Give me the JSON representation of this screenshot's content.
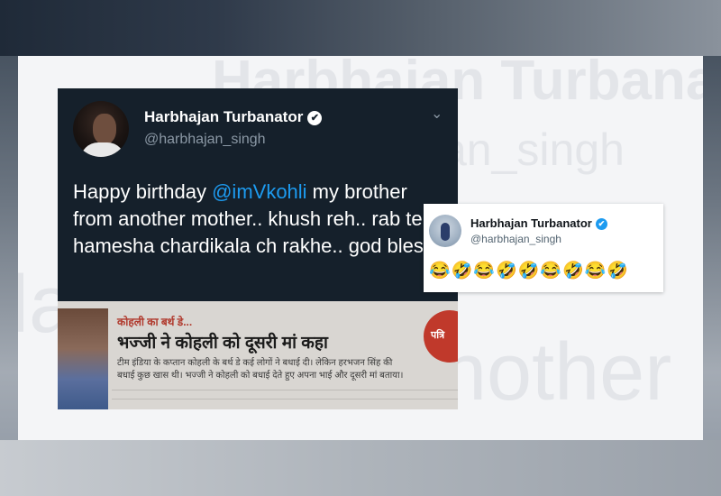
{
  "watermark": {
    "name": "Harbhajan Turbanator",
    "handle_fragment": "an_singh",
    "fragment_left": "la",
    "fragment_right": "nother"
  },
  "main_tweet": {
    "display_name": "Harbhajan Turbanator",
    "handle": "@harbhajan_singh",
    "verified_glyph": "✔",
    "more_glyph": "⌄",
    "text_before": "Happy birthday ",
    "mention": "@imVkohli",
    "text_after": " my brother from another mother.. khush reh.. rab tenu hamesha chardikala ch rakhe.. god bless",
    "accent": "#1d9bf0",
    "background": "#15202b"
  },
  "news_clipping": {
    "kicker": "कोहली का बर्थ डे...",
    "headline": "भज्जी ने कोहली को दूसरी मां कहा",
    "line1": "टीम इंडिया के कप्तान कोहली के बर्थ डे कई लोगों ने बधाई दी। लेकिन हरभजन सिंह की",
    "line2": "बधाई कुछ खास थी। भज्जी ने कोहली को बधाई देते हुए अपना भाई और दूसरी मां बताया।",
    "logo_text": "पत्रि"
  },
  "reply_tweet": {
    "display_name": "Harbhajan Turbanator",
    "handle": "@harbhajan_singh",
    "verified_glyph": "✔",
    "emojis": "😂🤣😂🤣🤣😂🤣😂🤣"
  }
}
